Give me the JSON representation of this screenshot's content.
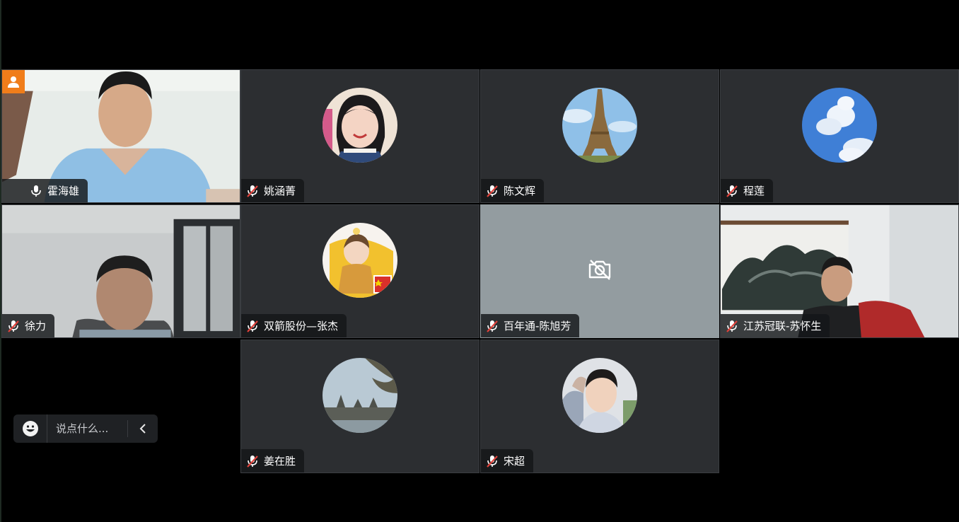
{
  "participants": [
    {
      "name": "霍海雄",
      "host": true,
      "mic": "on",
      "view": "video"
    },
    {
      "name": "姚涵菁",
      "mic": "muted",
      "view": "avatar",
      "avatar_icon": "girl-portrait-avatar"
    },
    {
      "name": "陈文辉",
      "mic": "muted",
      "view": "avatar",
      "avatar_icon": "eiffel-tower-avatar"
    },
    {
      "name": "程莲",
      "mic": "muted",
      "view": "avatar",
      "avatar_icon": "sky-clouds-avatar"
    },
    {
      "name": "徐力",
      "mic": "muted",
      "view": "video"
    },
    {
      "name": "双箭股份—张杰",
      "mic": "muted",
      "view": "avatar",
      "avatar_icon": "toddler-avatar"
    },
    {
      "name": "百年通-陈旭芳",
      "mic": "muted",
      "view": "camera-off",
      "icon": "camera-off-icon"
    },
    {
      "name": "江苏冠联-苏怀生",
      "mic": "muted",
      "view": "video"
    },
    {
      "name": "姜在胜",
      "mic": "muted",
      "view": "avatar",
      "avatar_icon": "temple-landscape-avatar"
    },
    {
      "name": "宋超",
      "mic": "muted",
      "view": "avatar",
      "avatar_icon": "man-selfie-avatar"
    }
  ],
  "chat": {
    "placeholder": "说点什么...",
    "emoji_icon": "smiley-icon",
    "collapse_icon": "chevron-left-icon"
  },
  "colors": {
    "tile_bg": "#2c2e31",
    "camera_off_bg": "#939ca0",
    "host_badge": "#f07d1a",
    "muted_slash": "#e0413a"
  }
}
